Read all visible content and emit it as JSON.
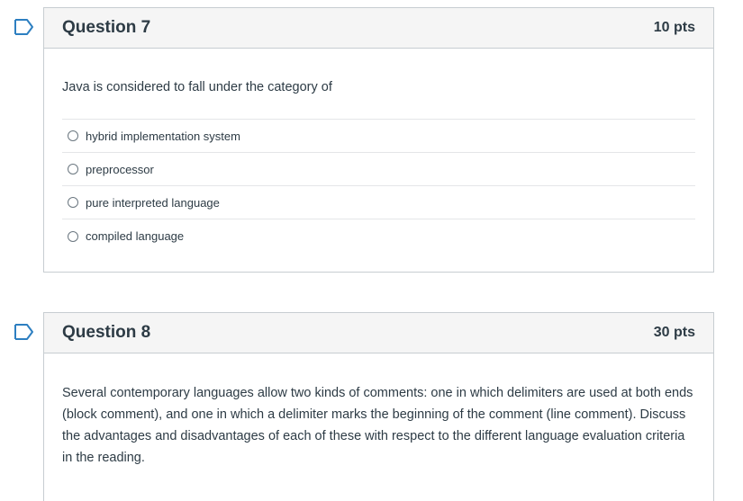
{
  "questions": [
    {
      "title": "Question 7",
      "points": "10 pts",
      "prompt": "Java is considered to fall under the category of",
      "answers": [
        "hybrid implementation system",
        "preprocessor",
        "pure interpreted language",
        "compiled language"
      ]
    },
    {
      "title": "Question 8",
      "points": "30 pts",
      "prompt": "Several contemporary languages allow two kinds of comments: one in which delimiters are used at both ends (block comment), and one in which a delimiter marks the beginning of the comment (line comment).  Discuss the advantages and disadvantages of each of these with respect to the different language evaluation criteria in the reading."
    }
  ],
  "icons": {
    "flag": "flag-icon"
  },
  "colors": {
    "flag_stroke": "#2d7fc1",
    "header_bg": "#f5f5f5",
    "border": "#c7cdd1",
    "text": "#2d3b45"
  }
}
